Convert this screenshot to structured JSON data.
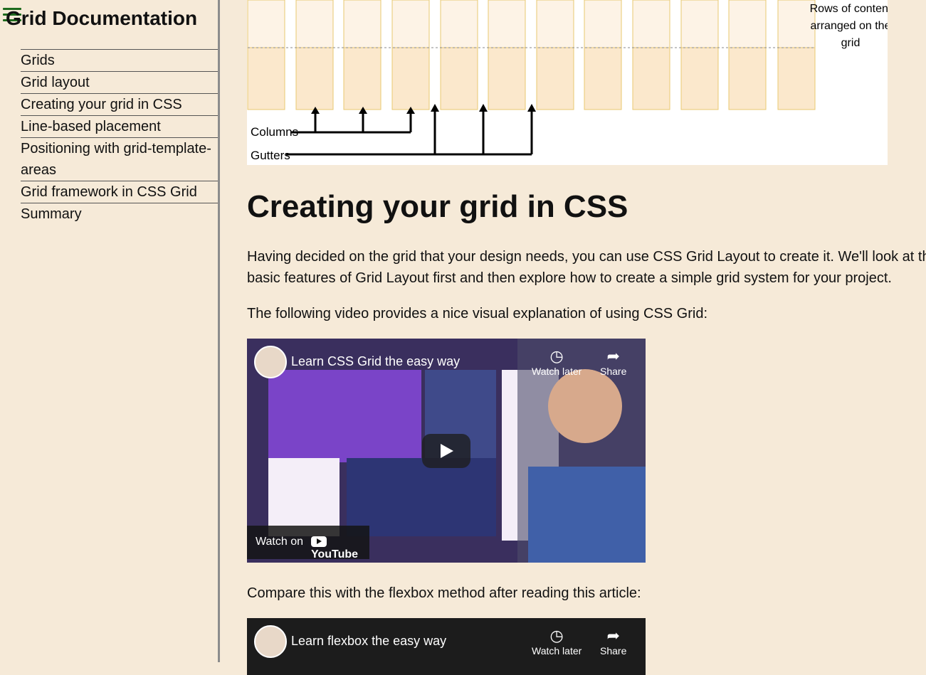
{
  "sidebar": {
    "title": "Grid Documentation",
    "items": [
      {
        "label": "Grids"
      },
      {
        "label": "Grid layout"
      },
      {
        "label": "Creating your grid in CSS"
      },
      {
        "label": "Line-based placement"
      },
      {
        "label": "Positioning with grid-template-areas"
      },
      {
        "label": "Grid framework in CSS Grid"
      },
      {
        "label": "Summary"
      }
    ]
  },
  "diagram": {
    "rows_label_1": "Rows of content",
    "rows_label_2": "arranged on the",
    "rows_label_3": "grid",
    "columns_label": "Columns",
    "gutters_label": "Gutters"
  },
  "main": {
    "heading": "Creating your grid in CSS",
    "para1": "Having decided on the grid that your design needs, you can use CSS Grid Layout to create it. We'll look at the basic features of Grid Layout first and then explore how to create a simple grid system for your project.",
    "para2": "The following video provides a nice visual explanation of using CSS Grid:",
    "para3": "Compare this with the flexbox method after reading this article:"
  },
  "video1": {
    "title": "Learn CSS Grid the easy way",
    "watch_later": "Watch later",
    "share": "Share",
    "watch_on": "Watch on",
    "youtube": "YouTube"
  },
  "video2": {
    "title": "Learn flexbox the easy way",
    "watch_later": "Watch later",
    "share": "Share"
  },
  "colors": {
    "background": "#f6ead8",
    "accent": "#1e6b1e"
  }
}
